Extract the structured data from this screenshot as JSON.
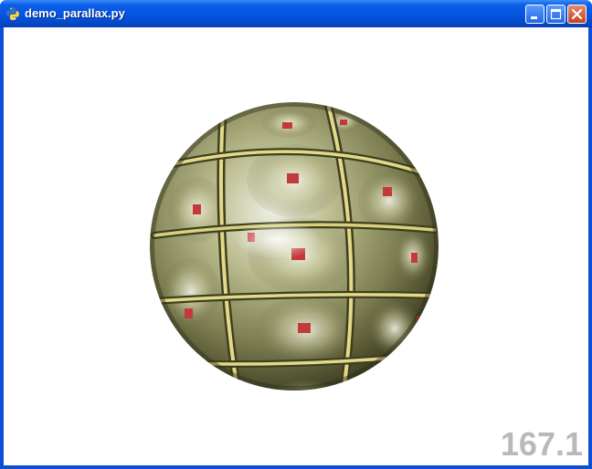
{
  "window": {
    "title": "demo_parallax.py",
    "app_icon": "python-icon",
    "controls": {
      "minimize_icon": "minimize-icon",
      "maximize_icon": "maximize-icon",
      "close_icon": "close-icon"
    }
  },
  "viewport": {
    "fps": "167.1",
    "background": "#ffffff",
    "object": "parallax-mapped-sphere"
  },
  "colors": {
    "titlebar": "#0554e0",
    "close_button": "#c7421f",
    "fps_text": "#b9b9b9"
  }
}
